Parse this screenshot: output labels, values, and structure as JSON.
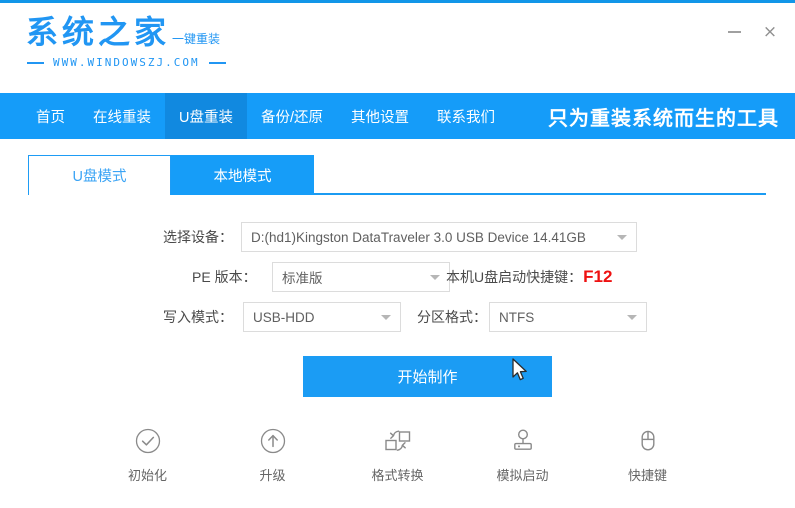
{
  "window": {
    "minimize_label": "—",
    "close_label": "×"
  },
  "brand": {
    "name": "系统之家",
    "tagline": "一键重装",
    "url": "WWW.WINDOWSZJ.COM",
    "accent_color": "#2196f3"
  },
  "nav": {
    "items": [
      {
        "label": "首页",
        "active": false
      },
      {
        "label": "在线重装",
        "active": false
      },
      {
        "label": "U盘重装",
        "active": true
      },
      {
        "label": "备份/还原",
        "active": false
      },
      {
        "label": "其他设置",
        "active": false
      },
      {
        "label": "联系我们",
        "active": false
      }
    ],
    "slogan": "只为重装系统而生的工具",
    "bar_color": "#159cf9",
    "active_color": "#1189e0"
  },
  "tabs": [
    {
      "label": "U盘模式",
      "selected": true
    },
    {
      "label": "本地模式",
      "selected": false
    }
  ],
  "form": {
    "device": {
      "label": "选择设备：",
      "value": "D:(hd1)Kingston DataTraveler 3.0 USB Device 14.41GB"
    },
    "pe_version": {
      "label": "PE 版本：",
      "value": "标准版"
    },
    "hotkey": {
      "label": "本机U盘启动快捷键：",
      "value": "F12",
      "color": "#ee1111"
    },
    "write_mode": {
      "label": "写入模式：",
      "value": "USB-HDD"
    },
    "partition_format": {
      "label": "分区格式：",
      "value": "NTFS"
    }
  },
  "primary_button": {
    "label": "开始制作",
    "color": "#1b9cf4"
  },
  "tools": [
    {
      "label": "初始化",
      "icon": "check-circle-icon"
    },
    {
      "label": "升级",
      "icon": "arrow-up-circle-icon"
    },
    {
      "label": "格式转换",
      "icon": "format-convert-icon"
    },
    {
      "label": "模拟启动",
      "icon": "joystick-icon"
    },
    {
      "label": "快捷键",
      "icon": "mouse-icon"
    }
  ]
}
